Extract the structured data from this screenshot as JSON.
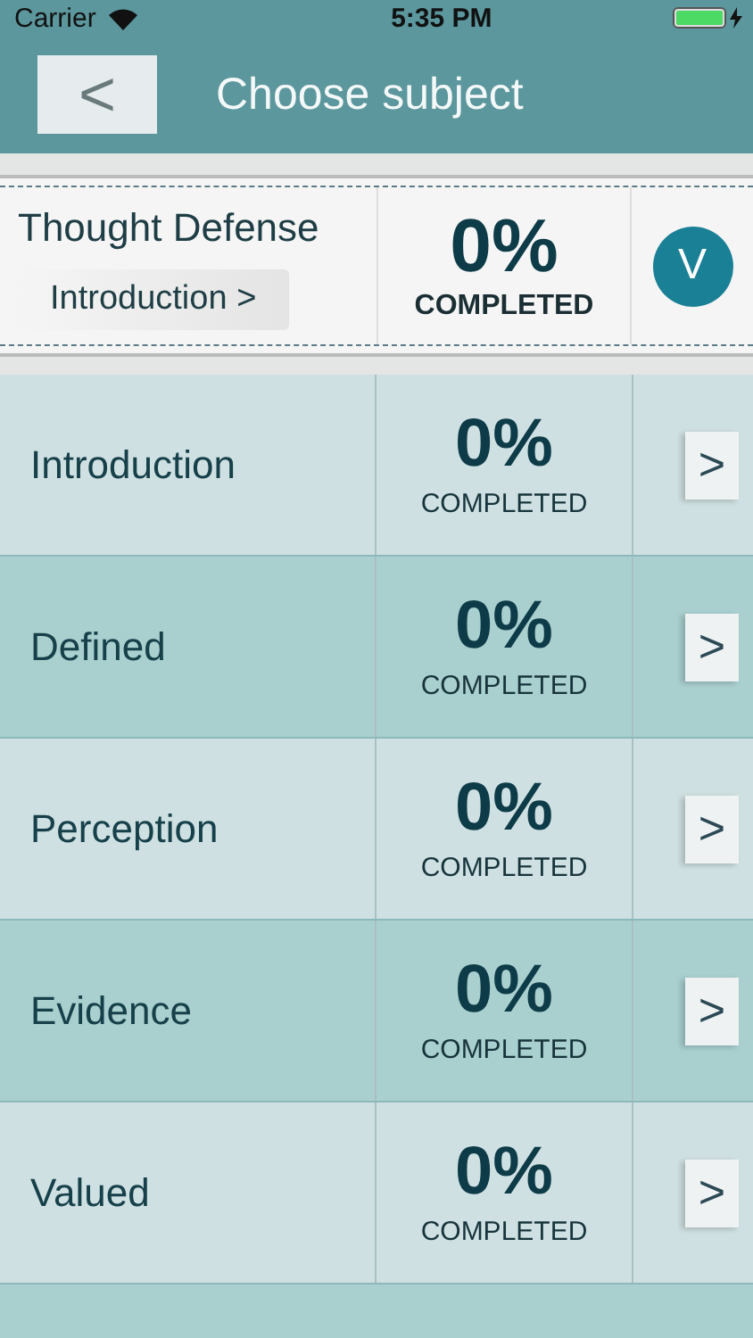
{
  "status_bar": {
    "carrier": "Carrier",
    "time": "5:35 PM"
  },
  "nav": {
    "back": "<",
    "title": "Choose subject"
  },
  "course": {
    "title": "Thought Defense",
    "current_lesson": "Introduction >",
    "percent": "0%",
    "status": "COMPLETED",
    "toggle": "V"
  },
  "subjects": [
    {
      "name": "Introduction",
      "percent": "0%",
      "status": "COMPLETED",
      "arrow": ">"
    },
    {
      "name": "Defined",
      "percent": "0%",
      "status": "COMPLETED",
      "arrow": ">"
    },
    {
      "name": "Perception",
      "percent": "0%",
      "status": "COMPLETED",
      "arrow": ">"
    },
    {
      "name": "Evidence",
      "percent": "0%",
      "status": "COMPLETED",
      "arrow": ">"
    },
    {
      "name": "Valued",
      "percent": "0%",
      "status": "COMPLETED",
      "arrow": ">"
    }
  ]
}
